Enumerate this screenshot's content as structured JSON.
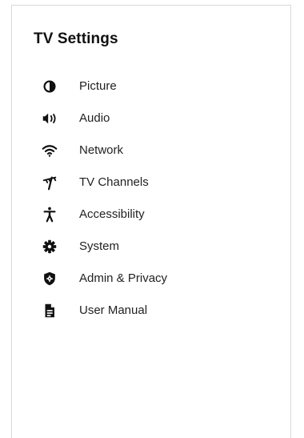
{
  "settings": {
    "title": "TV Settings",
    "items": [
      {
        "label": "Picture",
        "icon": "contrast-icon"
      },
      {
        "label": "Audio",
        "icon": "speaker-icon"
      },
      {
        "label": "Network",
        "icon": "wifi-icon"
      },
      {
        "label": "TV Channels",
        "icon": "antenna-icon"
      },
      {
        "label": "Accessibility",
        "icon": "accessibility-icon"
      },
      {
        "label": "System",
        "icon": "gear-icon"
      },
      {
        "label": "Admin & Privacy",
        "icon": "shield-icon"
      },
      {
        "label": "User Manual",
        "icon": "document-icon"
      }
    ]
  },
  "colors": {
    "text": "#111111",
    "border": "#d8d8d8",
    "background": "#ffffff"
  }
}
